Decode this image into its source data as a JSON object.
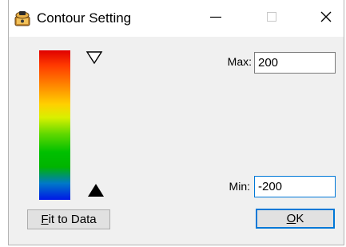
{
  "window": {
    "title": "Contour Setting",
    "icon": "app-icon",
    "controls": {
      "minimize": "minimize-icon",
      "maximize": "maximize-icon",
      "close": "close-icon"
    }
  },
  "colorbar": {
    "colors_top_to_bottom": [
      "#e00000",
      "#ff8a00",
      "#ffd000",
      "#d8f000",
      "#60d800",
      "#00c000",
      "#0078c8",
      "#0018e6"
    ],
    "top_marker": "triangle-outline-icon",
    "bottom_marker": "triangle-filled-icon"
  },
  "fields": {
    "max_label": "Max:",
    "max_value": "200",
    "min_label": "Min:",
    "min_value": "-200"
  },
  "buttons": {
    "fit_mnemonic": "F",
    "fit_rest": "it to Data",
    "ok_mnemonic": "O",
    "ok_rest": "K"
  },
  "colors": {
    "focus_border": "#0078d7",
    "window_bg": "#f0f0f0",
    "titlebar_bg": "#ffffff"
  }
}
